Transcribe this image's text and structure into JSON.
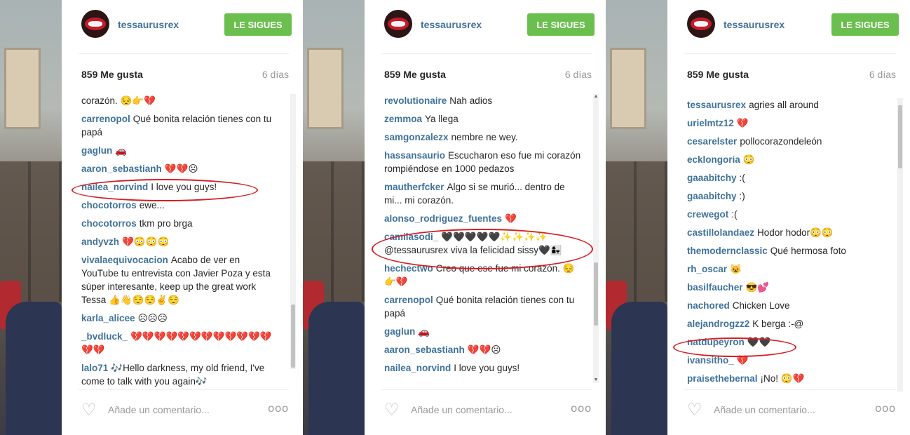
{
  "colors": {
    "follow_button": "#6bbf4e",
    "username": "#3f729b",
    "highlight_oval": "#d61e25"
  },
  "icons": {
    "avatar": "lips-avatar",
    "like": "heart-outline-icon",
    "options": "more-dots-icon"
  },
  "panels": [
    {
      "header": {
        "username": "tessaurusrex",
        "follow_label": "LE SIGUES"
      },
      "likes": "859 Me gusta",
      "age": "6 días",
      "comments": [
        {
          "user": "",
          "text": "corazón. 😔👉💔"
        },
        {
          "user": "carrenopol",
          "text": "Qué bonita relación tienes con tu papá"
        },
        {
          "user": "gaglun",
          "text": "🚗"
        },
        {
          "user": "aaron_sebastianh",
          "text": "💔💔☹"
        },
        {
          "user": "nailea_norvind",
          "text": "I love you guys!"
        },
        {
          "user": "chocotorros",
          "text": "ewe..."
        },
        {
          "user": "chocotorros",
          "text": "tkm pro brga"
        },
        {
          "user": "andyvzh",
          "text": "💔😳😳😳"
        },
        {
          "user": "vivalaequivocacion",
          "text": "Acabo de ver en YouTube tu entrevista con Javier Poza y esta súper interesante, keep up the great work Tessa 👍👋😌😌✌😌"
        },
        {
          "user": "karla_alicee",
          "text": "☹☹☹"
        },
        {
          "user": "_bvdluck_",
          "text": "💔💔💔💔💔💔💔💔💔💔💔💔💔💔"
        },
        {
          "user": "lalo71",
          "text": "🎶Hello darkness, my old friend, I've come to talk with you again🎶"
        }
      ],
      "add_placeholder": "Añade un comentario...",
      "more": "ooo"
    },
    {
      "header": {
        "username": "tessaurusrex",
        "follow_label": "LE SIGUES"
      },
      "likes": "859 Me gusta",
      "age": "6 días",
      "comments": [
        {
          "user": "revolutionaire",
          "text": "Nah adios"
        },
        {
          "user": "zemmoa",
          "text": "Ya llega"
        },
        {
          "user": "samgonzalezx",
          "text": "nembre ne wey."
        },
        {
          "user": "hassansaurio",
          "text": "Escucharon eso fue mi corazón rompiéndose en 1000 pedazos"
        },
        {
          "user": "mautherfcker",
          "text": "Algo si se murió... dentro de mi... mi corazón."
        },
        {
          "user": "alonso_rodriguez_fuentes",
          "text": "💔"
        },
        {
          "user": "camilasodi_",
          "text": "🖤🖤🖤🖤🖤✨✨✨✨ @tessaurusrex viva la felicidad sissy🖤👩‍👧"
        },
        {
          "user": "hechectwo",
          "text": "Creo que ese fue mi corazón. 😔👉💔"
        },
        {
          "user": "carrenopol",
          "text": "Qué bonita relación tienes con tu papá"
        },
        {
          "user": "gaglun",
          "text": "🚗"
        },
        {
          "user": "aaron_sebastianh",
          "text": "💔💔☹"
        },
        {
          "user": "nailea_norvind",
          "text": "I love you guys!"
        }
      ],
      "add_placeholder": "Añade un comentario...",
      "more": "ooo"
    },
    {
      "header": {
        "username": "tessaurusrex",
        "follow_label": "LE SIGUES"
      },
      "likes": "859 Me gusta",
      "age": "6 días",
      "comments": [
        {
          "user": "tessaurusrex",
          "text": "agries all around"
        },
        {
          "user": "urielmtz12",
          "text": "💔"
        },
        {
          "user": "cesarelster",
          "text": "pollocorazondeleón"
        },
        {
          "user": "ecklongoria",
          "text": "😳"
        },
        {
          "user": "gaaabitchy",
          "text": ":("
        },
        {
          "user": "gaaabitchy",
          "text": ":)"
        },
        {
          "user": "crewegot",
          "text": ":("
        },
        {
          "user": "castillolandaez",
          "text": "Hodor hodor😳😳"
        },
        {
          "user": "themodernclassic",
          "text": "Qué hermosa foto"
        },
        {
          "user": "rh_oscar",
          "text": "😺"
        },
        {
          "user": "basilfaucher",
          "text": "😎💕"
        },
        {
          "user": "nachored",
          "text": "Chicken Love"
        },
        {
          "user": "alejandrogzz2",
          "text": "K berga :-@"
        },
        {
          "user": "natdupeyron",
          "text": "🖤🖤"
        },
        {
          "user": "ivansitho_",
          "text": "💔"
        },
        {
          "user": "praisethebernal",
          "text": "¡No! 😳💔"
        }
      ],
      "add_placeholder": "Añade un comentario...",
      "more": "ooo"
    }
  ]
}
